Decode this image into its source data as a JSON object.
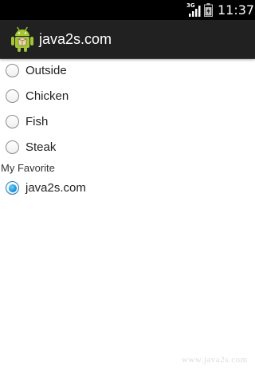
{
  "status_bar": {
    "network": "3G",
    "time": "11:37",
    "signal_icon": "signal-icon",
    "battery_icon": "battery-icon"
  },
  "action_bar": {
    "title": "java2s.com",
    "icon": "android-icon",
    "background": "#212121"
  },
  "group1": {
    "options": [
      {
        "label": "Outside",
        "checked": false
      },
      {
        "label": "Chicken",
        "checked": false
      },
      {
        "label": "Fish",
        "checked": false
      },
      {
        "label": "Steak",
        "checked": false
      }
    ]
  },
  "group2": {
    "title": "My Favorite",
    "options": [
      {
        "label": "java2s.com",
        "checked": true
      }
    ]
  },
  "accent_color": "#0e8ad6",
  "watermark": "www.java2s.com"
}
